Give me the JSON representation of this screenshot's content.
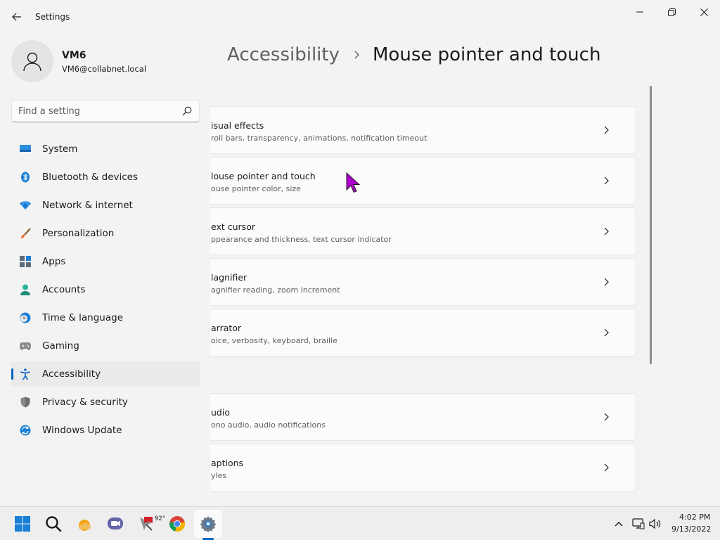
{
  "window": {
    "title": "Settings",
    "controls": {
      "minimize": "minimize-icon",
      "maximize": "restore-icon",
      "close": "close-icon"
    }
  },
  "profile": {
    "name": "VM6",
    "email": "VM6@collabnet.local"
  },
  "search": {
    "placeholder": "Find a setting"
  },
  "sidebar": {
    "items": [
      {
        "label": "System",
        "icon": "system-icon"
      },
      {
        "label": "Bluetooth & devices",
        "icon": "bluetooth-icon"
      },
      {
        "label": "Network & internet",
        "icon": "wifi-icon"
      },
      {
        "label": "Personalization",
        "icon": "paintbrush-icon"
      },
      {
        "label": "Apps",
        "icon": "apps-icon"
      },
      {
        "label": "Accounts",
        "icon": "accounts-icon"
      },
      {
        "label": "Time & language",
        "icon": "clock-globe-icon"
      },
      {
        "label": "Gaming",
        "icon": "gamepad-icon"
      },
      {
        "label": "Accessibility",
        "icon": "accessibility-icon",
        "selected": true
      },
      {
        "label": "Privacy & security",
        "icon": "shield-icon"
      },
      {
        "label": "Windows Update",
        "icon": "update-icon"
      }
    ]
  },
  "breadcrumb": {
    "parent": "Accessibility",
    "current": "Mouse pointer and touch"
  },
  "cards": [
    {
      "title": "isual effects",
      "subtitle": "roll bars, transparency, animations, notification timeout"
    },
    {
      "title": "louse pointer and touch",
      "subtitle": "ouse pointer color, size"
    },
    {
      "title": "ext cursor",
      "subtitle": "ppearance and thickness, text cursor indicator"
    },
    {
      "title": "lagnifier",
      "subtitle": "agnifier reading, zoom increment"
    },
    {
      "title": "arrator",
      "subtitle": "oice, verbosity, keyboard, braille"
    },
    {
      "title": "udio",
      "subtitle": "ono audio, audio notifications"
    },
    {
      "title": "aptions",
      "subtitle": "yles"
    }
  ],
  "taskbar": {
    "weather_temp": "92°",
    "apps": [
      "start-icon",
      "search-icon",
      "weather-icon",
      "teams-chat-icon",
      "app-icon",
      "chrome-icon",
      "settings-icon"
    ],
    "clock": {
      "time": "4:02 PM",
      "date": "9/13/2022"
    }
  },
  "colors": {
    "accent": "#0067c0",
    "background": "#f3f3f3",
    "card": "#fbfbfb",
    "cursor": "#b000d0"
  }
}
